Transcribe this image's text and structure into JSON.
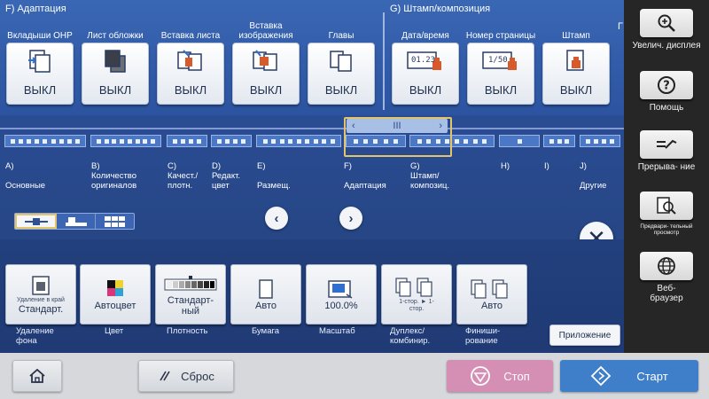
{
  "sections": {
    "adaptation_title": "F)  Адаптация",
    "stamp_title": "G)  Штамп/композиция",
    "cut_title": "Г"
  },
  "functions": [
    {
      "label": "Вкладыши OHP",
      "value": "ВЫКЛ",
      "icon": "ohp-insert-icon"
    },
    {
      "label": "Лист обложки",
      "value": "ВЫКЛ",
      "icon": "cover-sheet-icon"
    },
    {
      "label": "Вставка листа",
      "value": "ВЫКЛ",
      "icon": "insert-sheet-icon"
    },
    {
      "label": "Вставка изображения",
      "value": "ВЫКЛ",
      "icon": "insert-image-icon"
    },
    {
      "label": "Главы",
      "value": "ВЫКЛ",
      "icon": "chapters-icon"
    },
    {
      "label": "Дата/время",
      "value": "ВЫКЛ",
      "icon": "date-time-icon",
      "icon_text": "01.23"
    },
    {
      "label": "Номер страницы",
      "value": "ВЫКЛ",
      "icon": "page-number-icon",
      "icon_text": "1/50"
    },
    {
      "label": "Штамп",
      "value": "ВЫКЛ",
      "icon": "stamp-icon"
    }
  ],
  "nav": {
    "groups": [
      {
        "letter": "A)",
        "name": "Основные"
      },
      {
        "letter": "B)",
        "name": "Количество оригиналов"
      },
      {
        "letter": "C)",
        "name": "Качест./ плотн."
      },
      {
        "letter": "D)",
        "name": "Редакт. цвет"
      },
      {
        "letter": "E)",
        "name": "Размещ."
      },
      {
        "letter": "F)",
        "name": "Адаптация"
      },
      {
        "letter": "G)",
        "name": "Штамп/ композиц."
      },
      {
        "letter": "H)",
        "name": ""
      },
      {
        "letter": "I)",
        "name": ""
      },
      {
        "letter": "J)",
        "name": "Другие"
      }
    ],
    "scroll_thumb_mark": "III",
    "view_modes": [
      "list-view-icon",
      "card-view-icon",
      "grid-view-icon"
    ],
    "prev": "‹",
    "next": "›",
    "close": "✕"
  },
  "settings": [
    {
      "label": "Удаление фона",
      "small": "Удаление в край",
      "value": "Стандарт.",
      "icon": "background-removal-icon"
    },
    {
      "label": "Цвет",
      "small": "",
      "value": "Автоцвет",
      "icon": "color-mode-icon"
    },
    {
      "label": "Плотность",
      "small": "",
      "value": "Стандарт- ный",
      "icon": "density-icon"
    },
    {
      "label": "Бумага",
      "small": "",
      "value": "Авто",
      "icon": "paper-icon"
    },
    {
      "label": "Масштаб",
      "small": "",
      "value": "100.0%",
      "icon": "zoom-ratio-icon"
    },
    {
      "label": "Дуплекс/ комбинир.",
      "small": "1-стор. ► 1-стор.",
      "value": "",
      "icon": "duplex-icon"
    },
    {
      "label": "Финиши- рование",
      "small": "",
      "value": "Авто",
      "icon": "finishing-icon"
    }
  ],
  "application_button": "Приложение",
  "side_panel": [
    {
      "label": "Увелич. дисплея",
      "icon": "magnifier-icon"
    },
    {
      "label": "Помощь",
      "icon": "help-icon"
    },
    {
      "label": "Прерыва- ние",
      "icon": "interrupt-icon"
    },
    {
      "label": "Предвари- тельный просмотр",
      "icon": "preview-icon"
    },
    {
      "label": "Веб- браузер",
      "icon": "globe-icon"
    }
  ],
  "bottom_bar": {
    "home_icon": "home-icon",
    "reset": "Сброс",
    "stop": "Стоп",
    "start": "Старт"
  },
  "colors": {
    "accent_yellow": "#e3c46a",
    "stop_pink": "#d58fb4",
    "start_blue": "#3f7fc9",
    "panel_blue": "#2c539f"
  }
}
